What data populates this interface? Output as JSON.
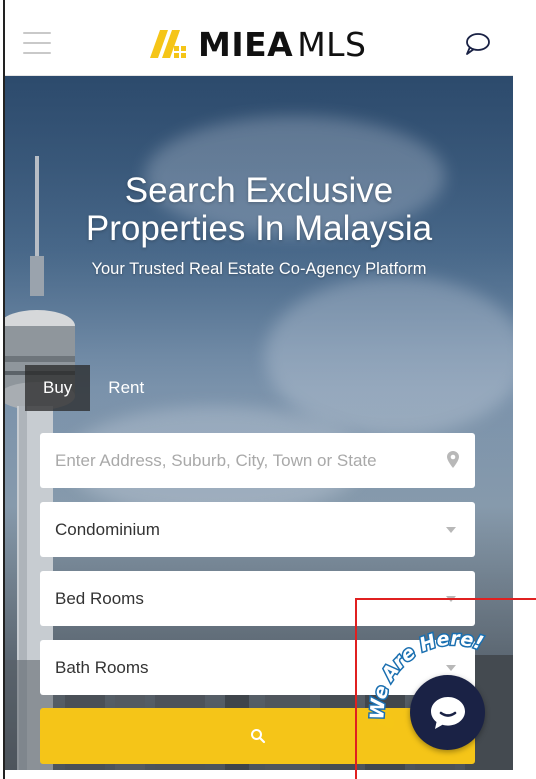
{
  "header": {
    "logo_bold": "MIEA",
    "logo_light": "MLS"
  },
  "hero": {
    "title_line1": "Search Exclusive",
    "title_line2": "Properties In Malaysia",
    "subtitle": "Your Trusted Real Estate Co-Agency Platform"
  },
  "tabs": [
    {
      "label": "Buy",
      "active": true
    },
    {
      "label": "Rent",
      "active": false
    }
  ],
  "search": {
    "address_placeholder": "Enter Address, Suburb, City, Town or State",
    "property_type_value": "Condominium",
    "bedrooms_value": "Bed Rooms",
    "bathrooms_value": "Bath Rooms"
  },
  "chat_widget": {
    "badge_text": "We Are Here!"
  },
  "colors": {
    "accent_yellow": "#f5c518",
    "chat_navy": "#1a2245",
    "annotation_red": "#e02020"
  },
  "icons": {
    "menu": "hamburger-icon",
    "chat_top": "chat-bubble-icon",
    "location": "map-pin-icon",
    "search": "search-icon",
    "dropdown": "caret-down-icon",
    "chat_widget": "chat-icon"
  }
}
